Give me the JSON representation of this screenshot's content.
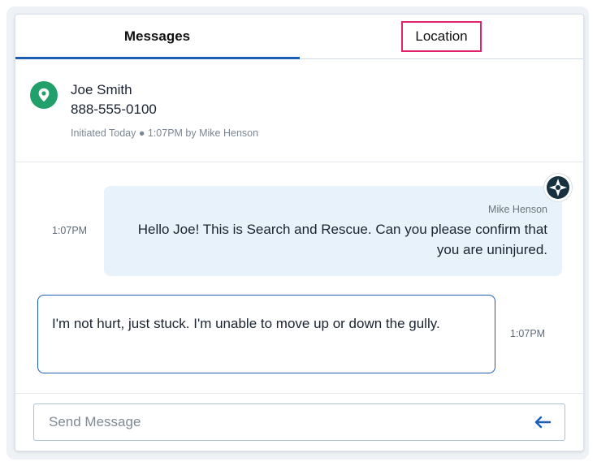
{
  "tabs": [
    {
      "label": "Messages",
      "active": true
    },
    {
      "label": "Location",
      "active": false
    }
  ],
  "contact": {
    "name": "Joe Smith",
    "phone": "888-555-0100",
    "meta": "Initiated Today ● 1:07PM by Mike Henson",
    "badge_icon": "map-pin-icon",
    "badge_color": "#22a06b"
  },
  "messages": [
    {
      "direction": "outgoing",
      "sender": "Mike Henson",
      "text": "Hello Joe! This is Search and Rescue. Can you please confirm that you are uninjured.",
      "time": "1:07PM",
      "avatar_icon": "cross-logo-icon"
    },
    {
      "direction": "incoming",
      "text": "I'm not hurt, just stuck. I'm unable to move up or down the gully.",
      "time": "1:07PM"
    }
  ],
  "composer": {
    "placeholder": "Send Message",
    "value": "",
    "send_icon": "arrow-left-icon"
  },
  "colors": {
    "accent": "#1a5fb4",
    "highlight": "#e0246c",
    "outgoing_bubble": "#e7f2fa"
  }
}
